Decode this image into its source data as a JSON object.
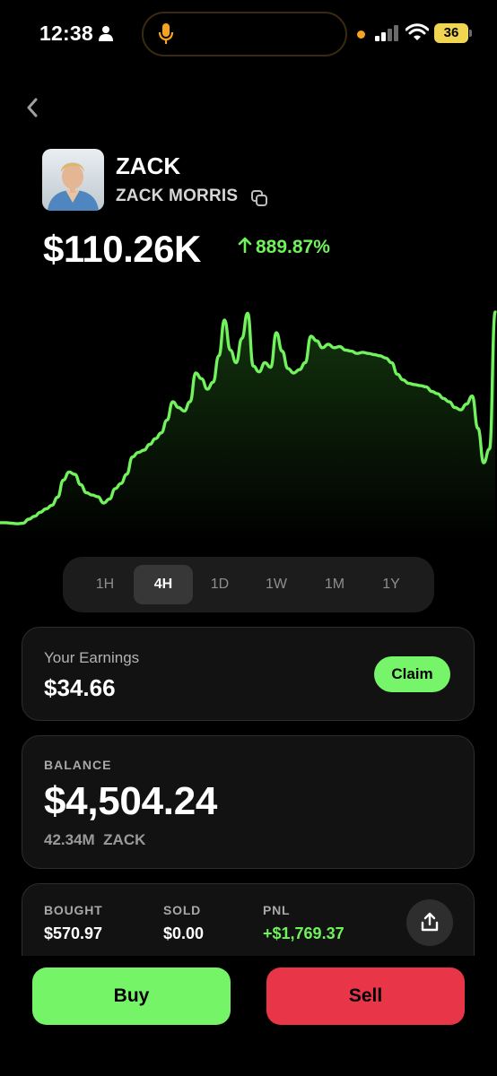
{
  "status_bar": {
    "time": "12:38",
    "battery": "36"
  },
  "token": {
    "ticker": "ZACK",
    "name": "ZACK MORRIS",
    "price": "$110.26K",
    "change": "889.87%",
    "change_color": "#6ff25a"
  },
  "chart_data": {
    "type": "line",
    "values": [
      0.8,
      0.8,
      0.7,
      0.6,
      0.7,
      1.4,
      1.9,
      2.6,
      3.2,
      3.8,
      5.2,
      8.2,
      9.6,
      9.2,
      7.4,
      6.0,
      5.6,
      5.3,
      4.2,
      4.9,
      6.7,
      7.6,
      9.2,
      12.2,
      13.0,
      13.4,
      14.4,
      15.4,
      16.4,
      18.6,
      21.8,
      20.8,
      20.2,
      21.8,
      26.8,
      25.8,
      24.0,
      25.2,
      29.8,
      36.0,
      30.8,
      28.6,
      32.8,
      37.2,
      28.0,
      27.0,
      28.6,
      27.8,
      33.8,
      30.6,
      27.6,
      26.8,
      27.4,
      28.6,
      33.2,
      32.4,
      31.2,
      31.8,
      31.2,
      31.4,
      30.8,
      30.6,
      30.2,
      30.4,
      30.2,
      30.0,
      29.8,
      29.4,
      28.6,
      26.6,
      25.6,
      25.0,
      24.8,
      24.6,
      24.4,
      23.6,
      23.2,
      22.4,
      21.8,
      20.8,
      20.4,
      21.4,
      22.8,
      17.2,
      11.2,
      13.6,
      37.4
    ],
    "accent_color": "#72f25c"
  },
  "timeframes": [
    "1H",
    "4H",
    "1D",
    "1W",
    "1M",
    "1Y"
  ],
  "active_timeframe": "4H",
  "earnings": {
    "label": "Your Earnings",
    "value": "$34.66",
    "claim_label": "Claim"
  },
  "balance": {
    "label": "BALANCE",
    "value": "$4,504.24",
    "amount": "42.34M",
    "unit": "ZACK"
  },
  "stats": {
    "bought_label": "BOUGHT",
    "bought_value": "$570.97",
    "sold_label": "SOLD",
    "sold_value": "$0.00",
    "pnl_label": "PNL",
    "pnl_value": "+$1,769.37"
  },
  "actions": {
    "buy_label": "Buy",
    "sell_label": "Sell",
    "buy_color": "#75f468",
    "sell_color": "#e93548"
  },
  "icons": [
    "person-icon",
    "microphone-icon",
    "cellular-signal-icon",
    "wifi-icon",
    "back-chevron-icon",
    "copy-icon",
    "arrow-up-icon",
    "share-icon"
  ]
}
